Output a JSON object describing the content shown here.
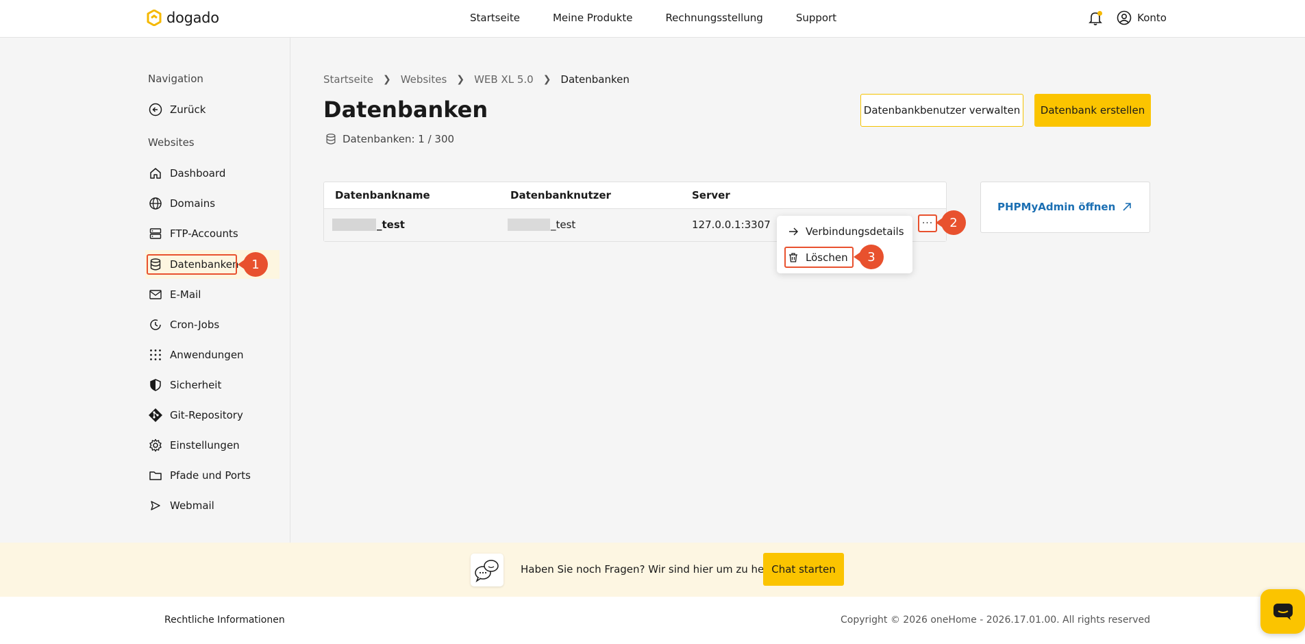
{
  "header": {
    "logo_text": "dogado",
    "nav": [
      "Startseite",
      "Meine Produkte",
      "Rechnungsstellung",
      "Support"
    ],
    "account_label": "Konto",
    "notification_dot_color": "#f5b800"
  },
  "sidebar": {
    "section_navigation": "Navigation",
    "back_label": "Zurück",
    "section_websites": "Websites",
    "items": [
      {
        "label": "Dashboard",
        "icon": "home-icon"
      },
      {
        "label": "Domains",
        "icon": "globe-icon"
      },
      {
        "label": "FTP-Accounts",
        "icon": "server-icon"
      },
      {
        "label": "Datenbanken",
        "icon": "database-icon",
        "active": true
      },
      {
        "label": "E-Mail",
        "icon": "mail-icon"
      },
      {
        "label": "Cron-Jobs",
        "icon": "clock-icon"
      },
      {
        "label": "Anwendungen",
        "icon": "grid-icon"
      },
      {
        "label": "Sicherheit",
        "icon": "shield-icon"
      },
      {
        "label": "Git-Repository",
        "icon": "git-icon"
      },
      {
        "label": "Einstellungen",
        "icon": "gear-icon"
      },
      {
        "label": "Pfade und Ports",
        "icon": "folder-icon"
      },
      {
        "label": "Webmail",
        "icon": "send-icon"
      }
    ]
  },
  "breadcrumb": [
    "Startseite",
    "Websites",
    "WEB XL 5.0",
    "Datenbanken"
  ],
  "page": {
    "title": "Datenbanken",
    "count_label": "Datenbanken: 1 / 300",
    "manage_users_button": "Datenbankbenutzer verwalten",
    "create_button": "Datenbank erstellen"
  },
  "table": {
    "headers": [
      "Datenbankname",
      "Datenbanknutzer",
      "Server"
    ],
    "rows": [
      {
        "name_suffix": "_test",
        "user_suffix": "_test",
        "server": "127.0.0.1:3307"
      }
    ],
    "more_button": "···"
  },
  "context_menu": {
    "items": [
      "Verbindungsdetails",
      "Löschen"
    ]
  },
  "phpmyadmin": {
    "label": "PHPMyAdmin öffnen"
  },
  "annotations": {
    "steps": [
      "1",
      "2",
      "3"
    ],
    "color": "#e8512e"
  },
  "help": {
    "text": "Haben Sie noch Fragen? Wir sind hier um zu helfen.",
    "chat_button": "Chat starten"
  },
  "footer": {
    "legal": "Rechtliche Informationen",
    "copyright": "Copyright © 2026 oneHome - 2026.17.01.00. All rights reserved"
  },
  "colors": {
    "accent": "#fbc400",
    "link": "#1b6fb3"
  }
}
